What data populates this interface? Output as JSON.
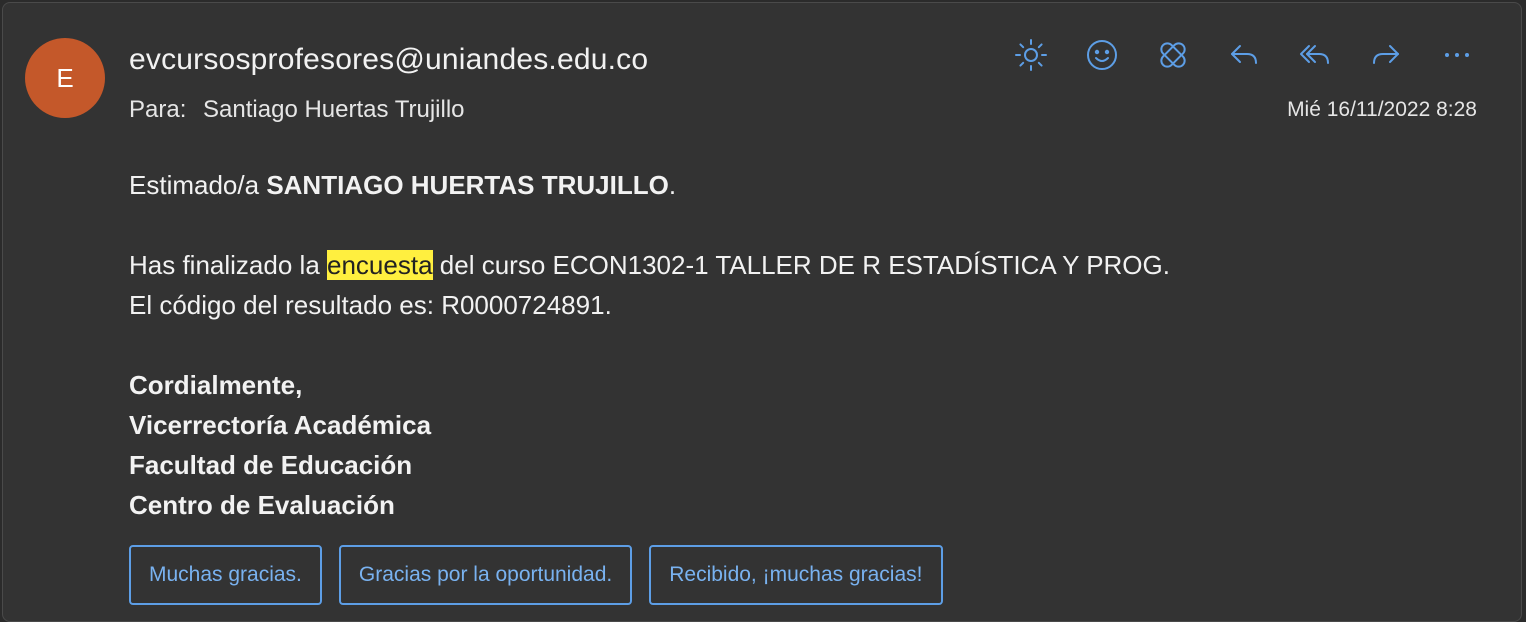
{
  "message": {
    "avatar_initial": "E",
    "sender": "evcursosprofesores@uniandes.edu.co",
    "to_label": "Para:",
    "to_name": "Santiago Huertas Trujillo",
    "date": "Mié 16/11/2022 8:28"
  },
  "toolbar": {
    "icons": [
      "sun-icon",
      "smiley-icon",
      "bandage-icon",
      "reply-icon",
      "reply-all-icon",
      "forward-icon",
      "more-icon"
    ],
    "accent_color": "#5d9ee6"
  },
  "body": {
    "greeting_prefix": "Estimado/a",
    "greeting_name": "SANTIAGO HUERTAS TRUJILLO",
    "greeting_suffix": ".",
    "line1_prefix": "Has finalizado la",
    "line1_highlight": "encuesta",
    "line1_suffix": "del curso ECON1302-1 TALLER DE R ESTADÍSTICA Y PROG.",
    "line2": "El código del resultado es: R0000724891.",
    "signature": [
      "Cordialmente,",
      "Vicerrectoría Académica",
      "Facultad de Educación",
      "Centro de Evaluación"
    ]
  },
  "quick_replies": [
    "Muchas gracias.",
    "Gracias por la oportunidad.",
    "Recibido, ¡muchas gracias!"
  ],
  "colors": {
    "avatar": "#c4582a",
    "highlight": "#ffef3f",
    "background": "#333333"
  }
}
